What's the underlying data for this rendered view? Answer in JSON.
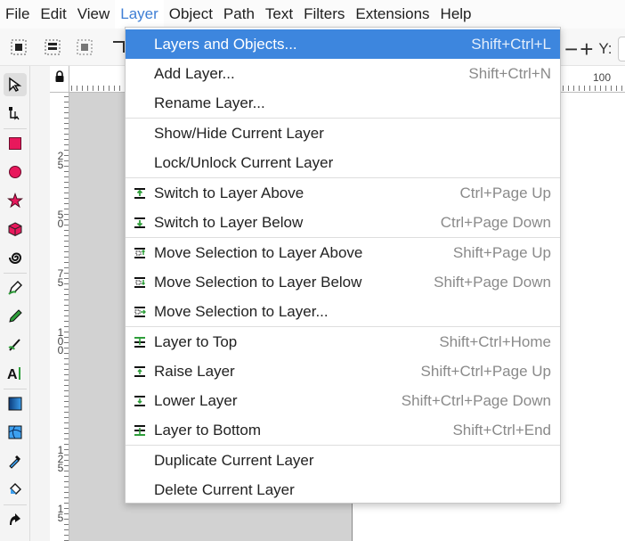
{
  "menubar": {
    "items": [
      {
        "label": "File"
      },
      {
        "label": "Edit"
      },
      {
        "label": "View"
      },
      {
        "label": "Layer",
        "active": true
      },
      {
        "label": "Object"
      },
      {
        "label": "Path"
      },
      {
        "label": "Text"
      },
      {
        "label": "Filters"
      },
      {
        "label": "Extensions"
      },
      {
        "label": "Help"
      }
    ]
  },
  "toolbar": {
    "y_label": "Y:",
    "minus": "−",
    "plus": "+"
  },
  "rulers": {
    "h_label": "100",
    "v_labels": [
      "2\n5",
      "5\n0",
      "7\n5",
      "1\n0\n0",
      "1\n2\n5",
      "1\n5"
    ]
  },
  "layer_menu": {
    "groups": [
      [
        {
          "label": "Layers and Objects...",
          "accel": "Shift+Ctrl+L",
          "icon": "",
          "highlighted": true
        },
        {
          "label": "Add Layer...",
          "accel": "Shift+Ctrl+N",
          "icon": ""
        },
        {
          "label": "Rename Layer...",
          "accel": "",
          "icon": ""
        }
      ],
      [
        {
          "label": "Show/Hide Current Layer",
          "accel": "",
          "icon": ""
        },
        {
          "label": "Lock/Unlock Current Layer",
          "accel": "",
          "icon": ""
        }
      ],
      [
        {
          "label": "Switch to Layer Above",
          "accel": "Ctrl+Page Up",
          "icon": "layer-switch-up-icon"
        },
        {
          "label": "Switch to Layer Below",
          "accel": "Ctrl+Page Down",
          "icon": "layer-switch-down-icon"
        }
      ],
      [
        {
          "label": "Move Selection to Layer Above",
          "accel": "Shift+Page Up",
          "icon": "selection-move-up-icon"
        },
        {
          "label": "Move Selection to Layer Below",
          "accel": "Shift+Page Down",
          "icon": "selection-move-down-icon"
        },
        {
          "label": "Move Selection to Layer...",
          "accel": "",
          "icon": "selection-move-to-icon"
        }
      ],
      [
        {
          "label": "Layer to Top",
          "accel": "Shift+Ctrl+Home",
          "icon": "layer-top-icon"
        },
        {
          "label": "Raise Layer",
          "accel": "Shift+Ctrl+Page Up",
          "icon": "layer-raise-icon"
        },
        {
          "label": "Lower Layer",
          "accel": "Shift+Ctrl+Page Down",
          "icon": "layer-lower-icon"
        },
        {
          "label": "Layer to Bottom",
          "accel": "Shift+Ctrl+End",
          "icon": "layer-bottom-icon"
        }
      ],
      [
        {
          "label": "Duplicate Current Layer",
          "accel": "",
          "icon": ""
        },
        {
          "label": "Delete Current Layer",
          "accel": "",
          "icon": ""
        }
      ]
    ]
  },
  "colors": {
    "highlight": "#3d86de",
    "accel_text": "#8a8a8a",
    "icon_green": "#2e9e3a"
  }
}
